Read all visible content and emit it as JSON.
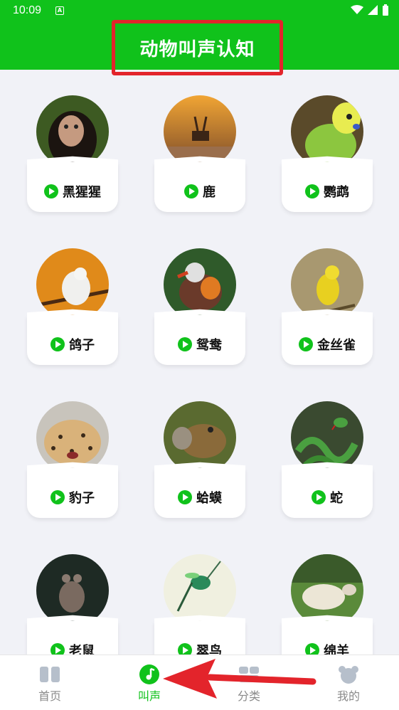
{
  "status_bar": {
    "time": "10:09"
  },
  "header": {
    "title": "动物叫声认知"
  },
  "animals": [
    {
      "name": "黑猩猩"
    },
    {
      "name": "鹿"
    },
    {
      "name": "鹦鹉"
    },
    {
      "name": "鸽子"
    },
    {
      "name": "鸳鸯"
    },
    {
      "name": "金丝雀"
    },
    {
      "name": "豹子"
    },
    {
      "name": "蛤蟆"
    },
    {
      "name": "蛇"
    },
    {
      "name": "老鼠"
    },
    {
      "name": "翠鸟"
    },
    {
      "name": "绵羊"
    }
  ],
  "bottom_nav": [
    {
      "label": "首页",
      "icon": "book-icon"
    },
    {
      "label": "叫声",
      "icon": "music-note-icon"
    },
    {
      "label": "分类",
      "icon": "category-icon"
    },
    {
      "label": "我的",
      "icon": "bear-face-icon"
    }
  ],
  "colors": {
    "accent": "#10c21b",
    "highlight": "#e3242b",
    "background": "#f1f2f7"
  }
}
